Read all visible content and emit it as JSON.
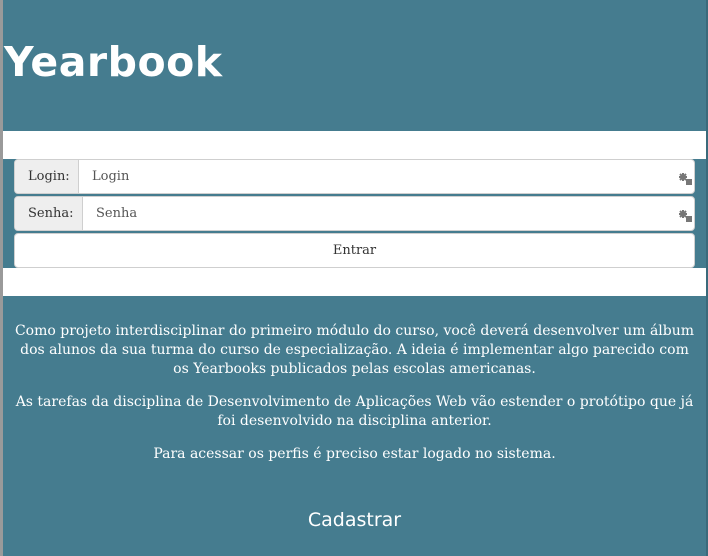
{
  "header": {
    "title": "Yearbook"
  },
  "login_form": {
    "login_label": "Login:",
    "login_placeholder": "Login",
    "password_label": "Senha:",
    "password_placeholder": "Senha",
    "submit_label": "Entrar"
  },
  "description": {
    "paragraphs": [
      "Como projeto interdisciplinar do primeiro módulo do curso, você deverá desenvolver um álbum dos alunos da sua turma do curso de especialização. A ideia é implementar algo parecido com os Yearbooks publicados pelas escolas americanas.",
      "As tarefas da disciplina de Desenvolvimento de Aplicações Web vão estender o protótipo que já foi desenvolvido na disciplina anterior.",
      "Para acessar os perfis é preciso estar logado no sistema."
    ]
  },
  "register_link": "Cadastrar",
  "colors": {
    "background": "#457c8f",
    "text": "#ffffff"
  }
}
